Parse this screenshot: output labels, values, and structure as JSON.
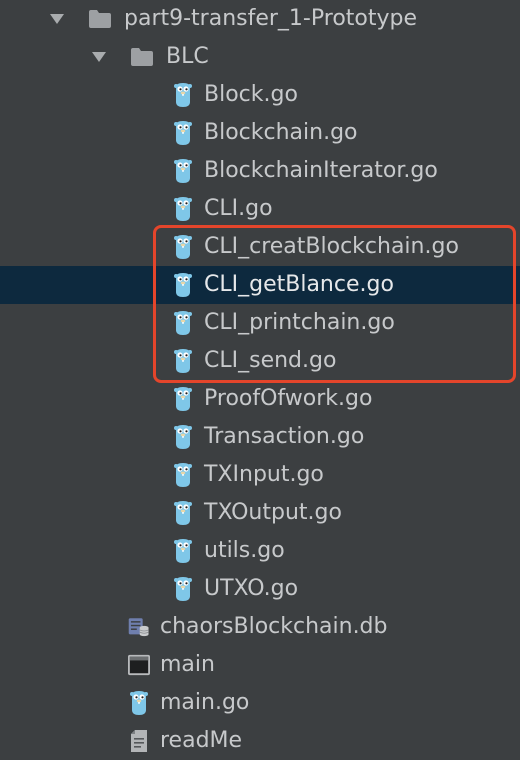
{
  "tree": {
    "root": {
      "label": "part9-transfer_1-Prototype",
      "expanded": true,
      "icon": "folder-icon"
    },
    "blc": {
      "label": "BLC",
      "expanded": true,
      "icon": "folder-icon",
      "files": [
        {
          "label": "Block.go",
          "icon": "gopher-icon"
        },
        {
          "label": "Blockchain.go",
          "icon": "gopher-icon"
        },
        {
          "label": "BlockchainIterator.go",
          "icon": "gopher-icon"
        },
        {
          "label": "CLI.go",
          "icon": "gopher-icon"
        },
        {
          "label": "CLI_creatBlockchain.go",
          "icon": "gopher-icon"
        },
        {
          "label": "CLI_getBlance.go",
          "icon": "gopher-icon",
          "selected": true
        },
        {
          "label": "CLI_printchain.go",
          "icon": "gopher-icon"
        },
        {
          "label": "CLI_send.go",
          "icon": "gopher-icon"
        },
        {
          "label": "ProofOfwork.go",
          "icon": "gopher-icon"
        },
        {
          "label": "Transaction.go",
          "icon": "gopher-icon"
        },
        {
          "label": "TXInput.go",
          "icon": "gopher-icon"
        },
        {
          "label": "TXOutput.go",
          "icon": "gopher-icon"
        },
        {
          "label": "utils.go",
          "icon": "gopher-icon"
        },
        {
          "label": "UTXO.go",
          "icon": "gopher-icon"
        }
      ]
    },
    "root_items": [
      {
        "label": "chaorsBlockchain.db",
        "icon": "database-icon"
      },
      {
        "label": "main",
        "icon": "terminal-icon"
      },
      {
        "label": "main.go",
        "icon": "gopher-icon"
      },
      {
        "label": "readMe",
        "icon": "text-file-icon"
      }
    ]
  },
  "colors": {
    "background": "#3c3f41",
    "selection": "#0d293e",
    "text": "#c7c9cb",
    "highlight_border": "#e4452b",
    "gopher": "#7fc7e8"
  }
}
